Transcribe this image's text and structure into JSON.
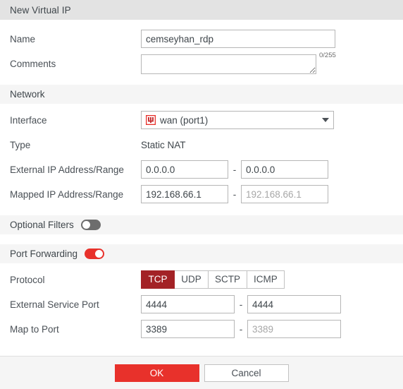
{
  "dialog": {
    "title": "New Virtual IP"
  },
  "general": {
    "name_label": "Name",
    "name_value": "cemseyhan_rdp",
    "comments_label": "Comments",
    "comments_value": "",
    "comments_placeholder": "",
    "comments_counter": "0/255"
  },
  "network": {
    "section_label": "Network",
    "interface_label": "Interface",
    "interface_value": "wan (port1)",
    "interface_icon": "physical-interface-icon",
    "type_label": "Type",
    "type_value": "Static NAT",
    "external_ip_label": "External IP Address/Range",
    "external_ip_start": "0.0.0.0",
    "external_ip_end": "0.0.0.0",
    "mapped_ip_label": "Mapped IP Address/Range",
    "mapped_ip_start": "192.168.66.1",
    "mapped_ip_end_placeholder": "192.168.66.1",
    "mapped_ip_end": "",
    "range_separator": "-"
  },
  "optional_filters": {
    "section_label": "Optional Filters",
    "enabled": false
  },
  "port_forwarding": {
    "section_label": "Port Forwarding",
    "enabled": true,
    "protocol_label": "Protocol",
    "protocols": [
      "TCP",
      "UDP",
      "SCTP",
      "ICMP"
    ],
    "protocol_selected": "TCP",
    "external_port_label": "External Service Port",
    "external_port_start": "4444",
    "external_port_end": "4444",
    "map_port_label": "Map to Port",
    "map_port_start": "3389",
    "map_port_end_placeholder": "3389",
    "map_port_end": "",
    "range_separator": "-"
  },
  "footer": {
    "ok_label": "OK",
    "cancel_label": "Cancel"
  },
  "colors": {
    "accent_red": "#e8312b",
    "selected_red": "#a32226",
    "titlebar_gray": "#e3e3e3",
    "section_gray": "#f5f5f5",
    "toggle_off_gray": "#6d6d6d"
  }
}
